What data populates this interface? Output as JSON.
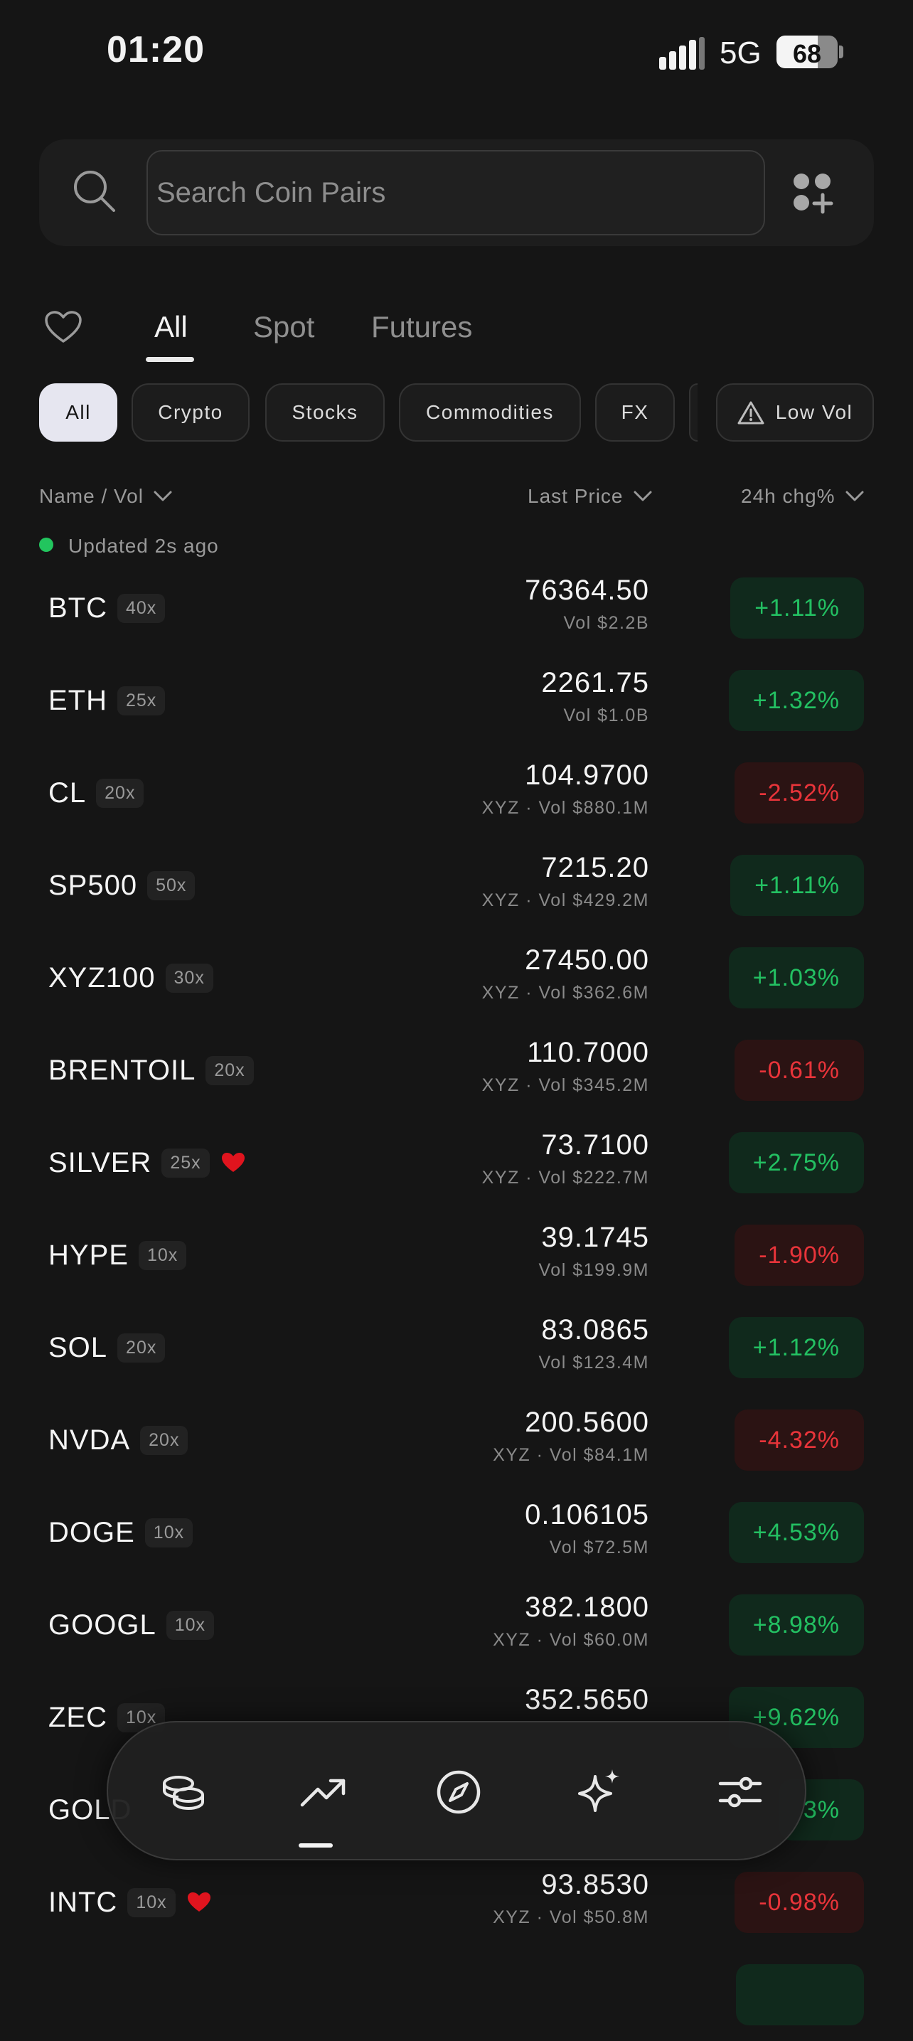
{
  "status_bar": {
    "time": "01:20",
    "network": "5G",
    "battery": "68",
    "battery_level": 0.68
  },
  "search": {
    "placeholder": "Search Coin Pairs",
    "value": ""
  },
  "tabs": [
    {
      "label": "All",
      "active": true
    },
    {
      "label": "Spot",
      "active": false
    },
    {
      "label": "Futures",
      "active": false
    }
  ],
  "chips": [
    {
      "label": "All",
      "active": true
    },
    {
      "label": "Crypto"
    },
    {
      "label": "Stocks"
    },
    {
      "label": "Commodities"
    },
    {
      "label": "FX"
    },
    {
      "label": "Low Vol",
      "icon": "warning-icon"
    }
  ],
  "columns": {
    "name_vol": "Name / Vol",
    "last_price": "Last Price",
    "change": "24h chg%"
  },
  "updated_text": "Updated 2s ago",
  "colors": {
    "up": "#23c062",
    "down": "#e8343a",
    "favorite": "#e0141e",
    "live_dot": "#22c55e"
  },
  "rows": [
    {
      "symbol": "BTC",
      "leverage": "40x",
      "favorite": false,
      "price": "76364.50",
      "volume": "Vol $2.2B",
      "change": "+1.11%",
      "direction": "up"
    },
    {
      "symbol": "ETH",
      "leverage": "25x",
      "favorite": false,
      "price": "2261.75",
      "volume": "Vol $1.0B",
      "change": "+1.32%",
      "direction": "up"
    },
    {
      "symbol": "CL",
      "leverage": "20x",
      "favorite": false,
      "price": "104.9700",
      "volume": "XYZ · Vol $880.1M",
      "change": "-2.52%",
      "direction": "down"
    },
    {
      "symbol": "SP500",
      "leverage": "50x",
      "favorite": false,
      "price": "7215.20",
      "volume": "XYZ · Vol $429.2M",
      "change": "+1.11%",
      "direction": "up"
    },
    {
      "symbol": "XYZ100",
      "leverage": "30x",
      "favorite": false,
      "price": "27450.00",
      "volume": "XYZ · Vol $362.6M",
      "change": "+1.03%",
      "direction": "up"
    },
    {
      "symbol": "BRENTOIL",
      "leverage": "20x",
      "favorite": false,
      "price": "110.7000",
      "volume": "XYZ · Vol $345.2M",
      "change": "-0.61%",
      "direction": "down"
    },
    {
      "symbol": "SILVER",
      "leverage": "25x",
      "favorite": true,
      "price": "73.7100",
      "volume": "XYZ · Vol $222.7M",
      "change": "+2.75%",
      "direction": "up"
    },
    {
      "symbol": "HYPE",
      "leverage": "10x",
      "favorite": false,
      "price": "39.1745",
      "volume": "Vol $199.9M",
      "change": "-1.90%",
      "direction": "down"
    },
    {
      "symbol": "SOL",
      "leverage": "20x",
      "favorite": false,
      "price": "83.0865",
      "volume": "Vol $123.4M",
      "change": "+1.12%",
      "direction": "up"
    },
    {
      "symbol": "NVDA",
      "leverage": "20x",
      "favorite": false,
      "price": "200.5600",
      "volume": "XYZ · Vol $84.1M",
      "change": "-4.32%",
      "direction": "down"
    },
    {
      "symbol": "DOGE",
      "leverage": "10x",
      "favorite": false,
      "price": "0.106105",
      "volume": "Vol $72.5M",
      "change": "+4.53%",
      "direction": "up"
    },
    {
      "symbol": "GOOGL",
      "leverage": "10x",
      "favorite": false,
      "price": "382.1800",
      "volume": "XYZ · Vol $60.0M",
      "change": "+8.98%",
      "direction": "up"
    },
    {
      "symbol": "ZEC",
      "leverage": "10x",
      "favorite": false,
      "price": "352.5650",
      "volume": "",
      "change": "+9.62%",
      "direction": "up"
    },
    {
      "symbol": "GOLD",
      "leverage": "",
      "favorite": false,
      "price": "",
      "volume": "",
      "change": "3%",
      "direction": "up"
    },
    {
      "symbol": "INTC",
      "leverage": "10x",
      "favorite": true,
      "price": "93.8530",
      "volume": "XYZ · Vol $50.8M",
      "change": "-0.98%",
      "direction": "down"
    },
    {
      "symbol": "",
      "leverage": "",
      "favorite": false,
      "price": "",
      "volume": "",
      "change": "",
      "direction": "up"
    }
  ],
  "bottom_nav": [
    {
      "icon": "coins-icon",
      "active": false
    },
    {
      "icon": "trending-up-icon",
      "active": true
    },
    {
      "icon": "compass-icon",
      "active": false
    },
    {
      "icon": "sparkles-icon",
      "active": false
    },
    {
      "icon": "sliders-icon",
      "active": false
    }
  ]
}
